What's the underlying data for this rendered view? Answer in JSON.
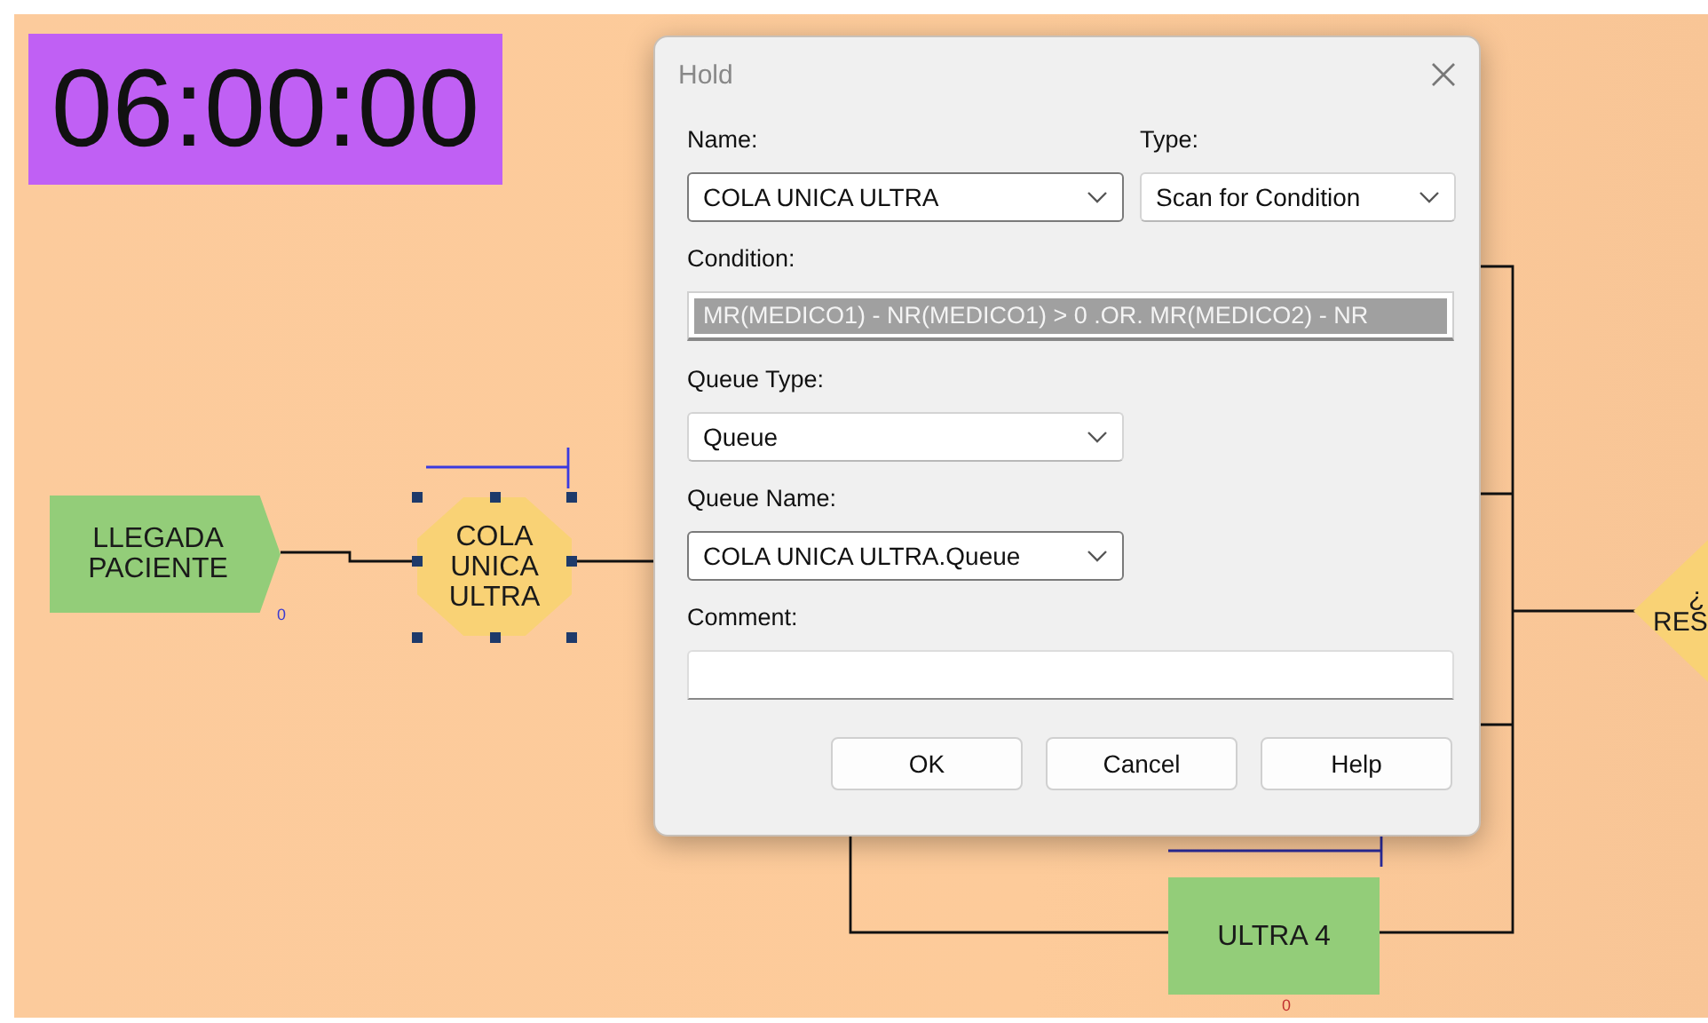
{
  "canvas": {
    "clock": "06:00:00",
    "nodes": [
      {
        "kind": "arrive",
        "label": [
          "LLEGADA",
          "PACIENTE"
        ],
        "counter": "0"
      },
      {
        "kind": "hold",
        "label": [
          "COLA",
          "UNICA",
          "ULTRA"
        ],
        "selected": true
      },
      {
        "kind": "decision",
        "label": [
          "¿",
          "RES"
        ]
      },
      {
        "kind": "activity",
        "label": [
          "ULTRA 4"
        ],
        "counter": "0"
      }
    ]
  },
  "dialog": {
    "title": "Hold",
    "name": {
      "label": "Name:",
      "value": "COLA UNICA ULTRA"
    },
    "type": {
      "label": "Type:",
      "value": "Scan for Condition"
    },
    "condition": {
      "label": "Condition:",
      "value": "MR(MEDICO1) - NR(MEDICO1) > 0 .OR. MR(MEDICO2) - NR",
      "disabled": true
    },
    "queue_type": {
      "label": "Queue Type:",
      "value": "Queue"
    },
    "queue_name": {
      "label": "Queue Name:",
      "value": "COLA UNICA ULTRA.Queue"
    },
    "comment": {
      "label": "Comment:"
    },
    "buttons": [
      "OK",
      "Cancel",
      "Help"
    ]
  }
}
